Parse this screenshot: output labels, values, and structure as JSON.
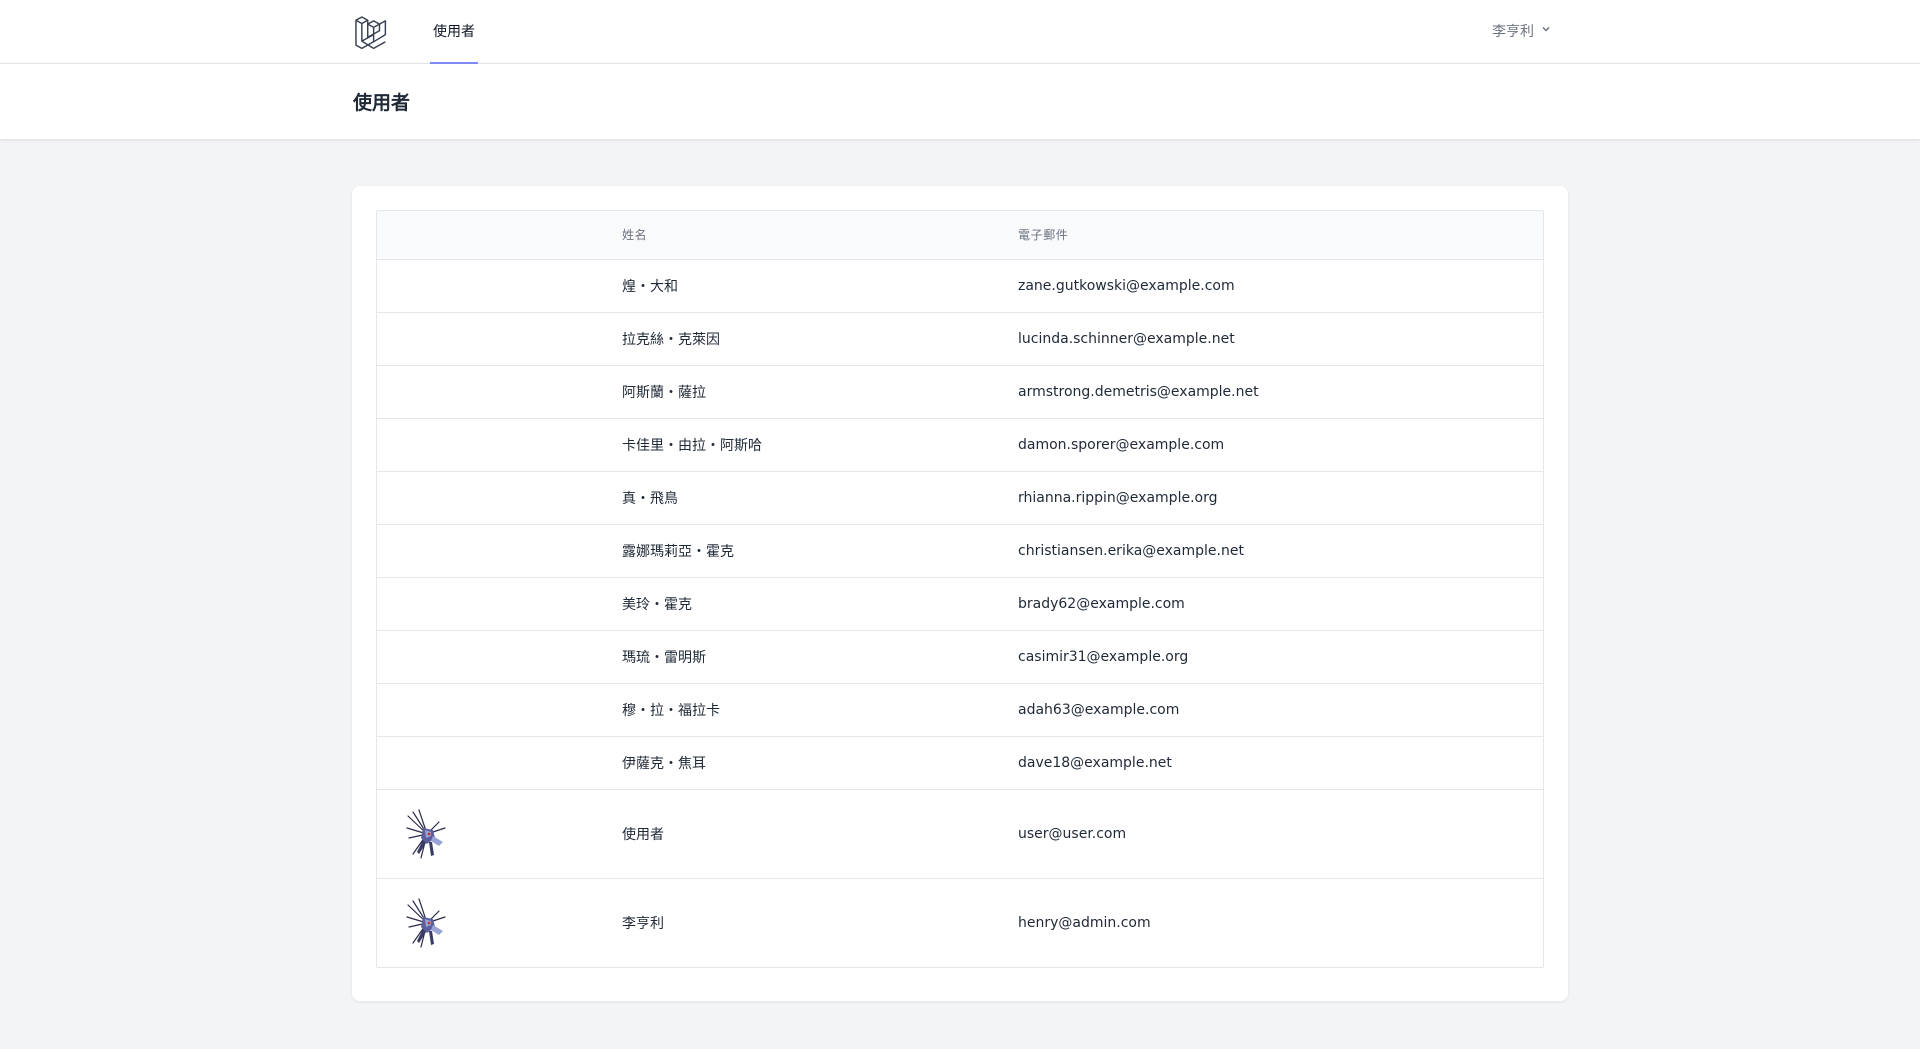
{
  "nav": {
    "link_users": "使用者",
    "user_name": "李亨利"
  },
  "header": {
    "title": "使用者"
  },
  "table": {
    "columns": {
      "avatar": "",
      "name": "姓名",
      "email": "電子郵件"
    },
    "rows": [
      {
        "name": "煌・大和",
        "email": "zane.gutkowski@example.com"
      },
      {
        "name": "拉克絲・克萊因",
        "email": "lucinda.schinner@example.net"
      },
      {
        "name": "阿斯蘭・薩拉",
        "email": "armstrong.demetris@example.net"
      },
      {
        "name": "卡佳里・由拉・阿斯哈",
        "email": "damon.sporer@example.com"
      },
      {
        "name": "真・飛鳥",
        "email": "rhianna.rippin@example.org"
      },
      {
        "name": "露娜瑪莉亞・霍克",
        "email": "christiansen.erika@example.net"
      },
      {
        "name": "美玲・霍克",
        "email": "brady62@example.com"
      },
      {
        "name": "瑪琉・雷明斯",
        "email": "casimir31@example.org"
      },
      {
        "name": "穆・拉・福拉卡",
        "email": "adah63@example.com"
      },
      {
        "name": "伊薩克・焦耳",
        "email": "dave18@example.net"
      },
      {
        "name": "使用者",
        "email": "user@user.com",
        "avatar": "mecha-avatar"
      },
      {
        "name": "李亨利",
        "email": "henry@admin.com",
        "avatar": "mecha-avatar"
      }
    ]
  },
  "colors": {
    "accent": "#818cf8",
    "background": "#f3f4f6",
    "border": "#e5e7eb"
  }
}
